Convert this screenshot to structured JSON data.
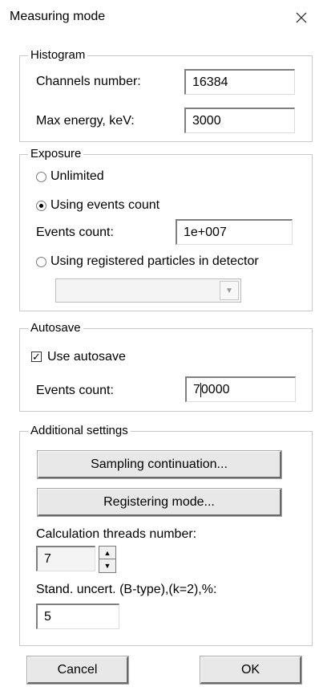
{
  "window": {
    "title": "Measuring mode"
  },
  "histogram": {
    "legend": "Histogram",
    "channels_label": "Channels number:",
    "channels_value": "16384",
    "max_energy_label": "Max energy, keV:",
    "max_energy_value": "3000"
  },
  "exposure": {
    "legend": "Exposure",
    "unlimited_label": "Unlimited",
    "events_option_label": "Using events count",
    "events_count_label": "Events count:",
    "events_count_value": "1e+007",
    "registered_label": "Using registered particles in detector",
    "selected_mode": "Using events count"
  },
  "autosave": {
    "legend": "Autosave",
    "use_label": "Use autosave",
    "use_checked": true,
    "events_count_label": "Events count:",
    "events_count_before_caret": "7",
    "events_count_after_caret": "0000"
  },
  "additional": {
    "legend": "Additional settings",
    "sampling_button": "Sampling continuation...",
    "registering_button": "Registering mode...",
    "threads_label": "Calculation threads number:",
    "threads_value": "7",
    "uncert_label": "Stand. uncert. (B-type),(k=2),%:",
    "uncert_value": "5"
  },
  "footer": {
    "cancel_label": "Cancel",
    "ok_label": "OK"
  }
}
